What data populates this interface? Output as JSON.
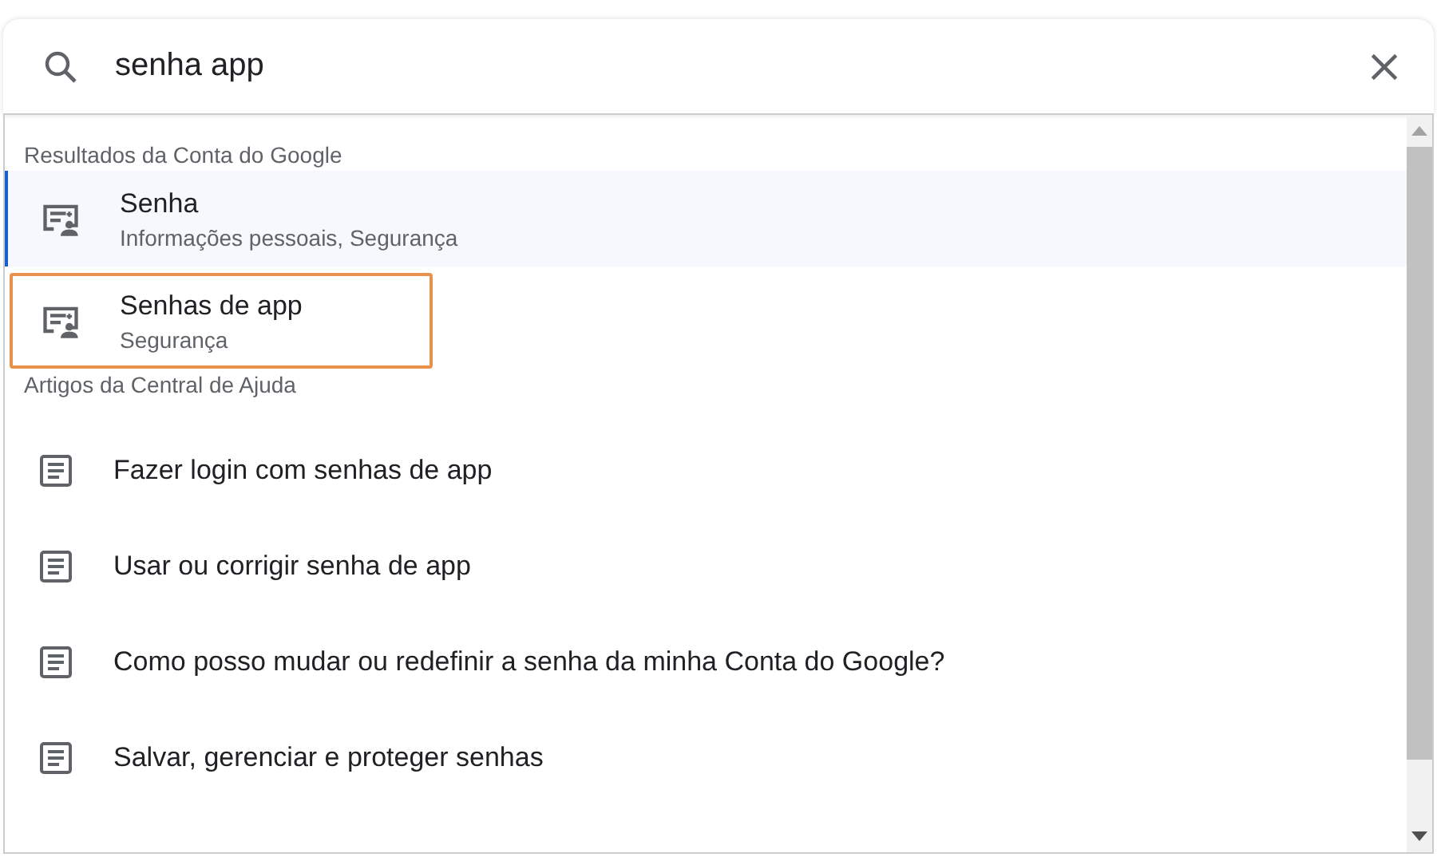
{
  "search": {
    "value": "senha app"
  },
  "sections": [
    {
      "heading": "Resultados da Conta do Google",
      "kind": "account",
      "items": [
        {
          "title": "Senha",
          "subtitle": "Informações pessoais, Segurança",
          "selected": true,
          "highlighted": false
        },
        {
          "title": "Senhas de app",
          "subtitle": "Segurança",
          "selected": false,
          "highlighted": true
        }
      ]
    },
    {
      "heading": "Artigos da Central de Ajuda",
      "kind": "article",
      "items": [
        {
          "title": "Fazer login com senhas de app"
        },
        {
          "title": "Usar ou corrigir senha de app"
        },
        {
          "title": "Como posso mudar ou redefinir a senha da minha Conta do Google?"
        },
        {
          "title": "Salvar, gerenciar e proteger senhas"
        }
      ]
    }
  ]
}
